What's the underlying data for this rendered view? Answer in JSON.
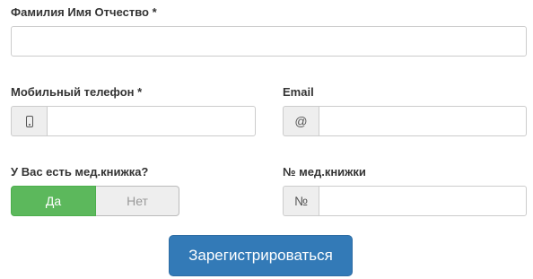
{
  "form": {
    "full_name": {
      "label": "Фамилия Имя Отчество *",
      "value": ""
    },
    "phone": {
      "label": "Мобильный телефон *",
      "addon_icon": "mobile-phone-icon",
      "value": ""
    },
    "email": {
      "label": "Email",
      "addon": "@",
      "value": ""
    },
    "med_book": {
      "question": "У Вас есть мед.книжка?",
      "yes_label": "Да",
      "no_label": "Нет",
      "selected": "Да"
    },
    "med_book_number": {
      "label": "№ мед.книжки",
      "addon": "№",
      "value": ""
    },
    "submit_label": "Зарегистрироваться"
  },
  "colors": {
    "accent_blue": "#337ab7",
    "toggle_green": "#5cb85c",
    "addon_gray": "#eeeeee"
  }
}
